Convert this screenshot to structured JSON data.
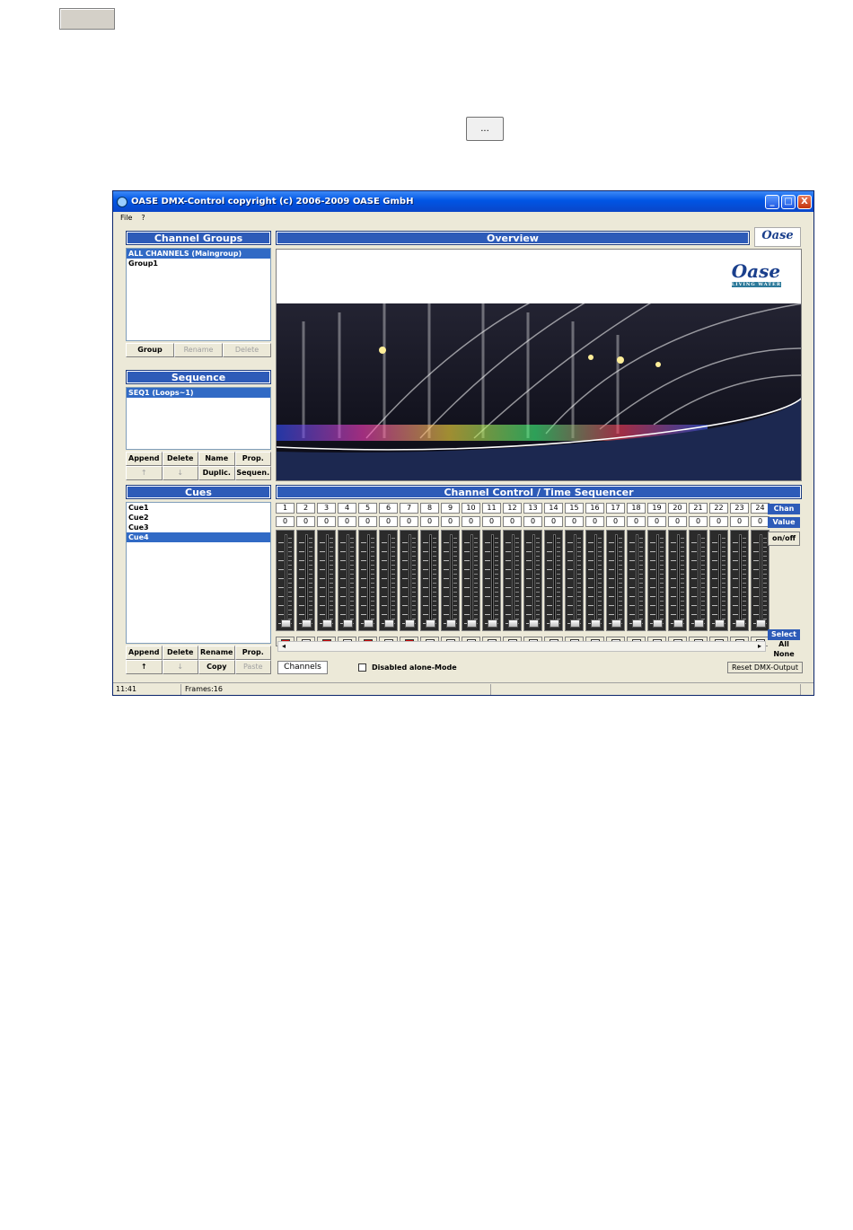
{
  "doc": {
    "ellipsis_label": "..."
  },
  "window": {
    "title": "OASE DMX-Control   copyright (c)  2006-2009 OASE GmbH",
    "min_symbol": "_",
    "max_symbol": "□",
    "close_symbol": "X"
  },
  "menu": [
    "File",
    "?"
  ],
  "channel_groups": {
    "header": "Channel Groups",
    "items": [
      "ALL CHANNELS (Maingroup)",
      "Group1"
    ],
    "buttons": [
      "Group",
      "Rename",
      "Delete"
    ]
  },
  "sequence": {
    "header": "Sequence",
    "items": [
      "SEQ1  (Loops~1)"
    ],
    "buttons": [
      "Append",
      "Delete",
      "Name",
      "Prop.",
      "↑",
      "↓",
      "Duplic.",
      "Sequen."
    ]
  },
  "cues": {
    "header": "Cues",
    "items": [
      "Cue1",
      "Cue2",
      "Cue3",
      "Cue4"
    ],
    "buttons": [
      "Append",
      "Delete",
      "Rename",
      "Prop.",
      "↑",
      "↓",
      "Copy",
      "Paste"
    ]
  },
  "overview": {
    "header": "Overview",
    "logo_text": "Oase",
    "logo_subtext": "LIVING WATER"
  },
  "channel_control": {
    "header": "Channel Control  /  Time Sequencer",
    "channels": [
      "1",
      "2",
      "3",
      "4",
      "5",
      "6",
      "7",
      "8",
      "9",
      "10",
      "11",
      "12",
      "13",
      "14",
      "15",
      "16",
      "17",
      "18",
      "19",
      "20",
      "21",
      "22",
      "23",
      "24"
    ],
    "values": [
      "0",
      "0",
      "0",
      "0",
      "0",
      "0",
      "0",
      "0",
      "0",
      "0",
      "0",
      "0",
      "0",
      "0",
      "0",
      "0",
      "0",
      "0",
      "0",
      "0",
      "0",
      "0",
      "0",
      "0"
    ],
    "onoff_states": [
      true,
      false,
      true,
      false,
      true,
      false,
      true,
      false,
      false,
      false,
      false,
      false,
      false,
      false,
      false,
      false,
      false,
      false,
      false,
      false,
      false,
      false,
      false,
      false
    ],
    "side": {
      "chan": "Chan",
      "value": "Value",
      "onoff": "on/off",
      "select": "Select",
      "all": "All",
      "none": "None"
    },
    "channels_tab": "Channels",
    "disabled_alone": "Disabled alone-Mode",
    "reset_button": "Reset DMX-Output"
  },
  "status": {
    "time": "11:41",
    "frames": "Frames:16"
  },
  "colors": {
    "header_blue": "#2d5bb8",
    "selection": "#316ac5",
    "window_bg": "#ece9d8",
    "led_on": "#d01010"
  }
}
